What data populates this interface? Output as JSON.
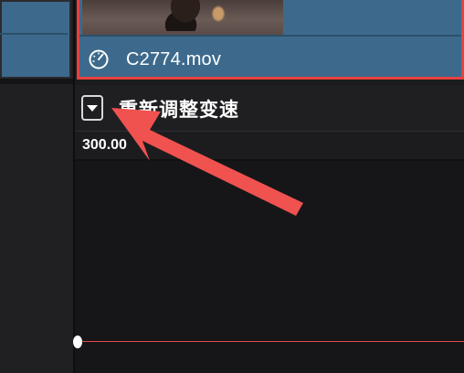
{
  "clip": {
    "name": "C2774.mov",
    "icon": "speedometer-icon"
  },
  "effect": {
    "title": "重新调整变速",
    "collapse_icon": "triangle-down-icon"
  },
  "speed": {
    "value": "300.00"
  },
  "colors": {
    "clip_fill": "#3d6a8c",
    "selection_border": "#e8413e",
    "annotation_arrow": "#f0524f",
    "speed_line": "#e24b48",
    "background": "#1b1b1e"
  }
}
